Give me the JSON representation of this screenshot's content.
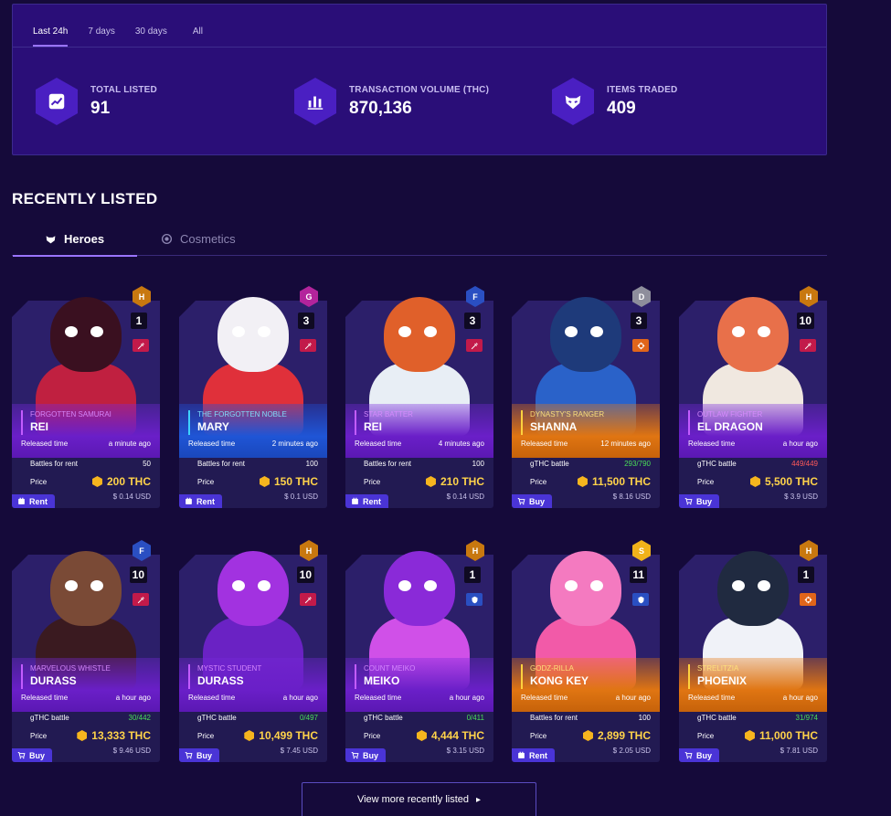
{
  "period_tabs": [
    "Last 24h",
    "7 days",
    "30 days",
    "All"
  ],
  "stats": [
    {
      "label": "TOTAL LISTED",
      "value": "91",
      "icon": "chart-up-icon"
    },
    {
      "label": "TRANSACTION VOLUME (THC)",
      "value": "870,136",
      "icon": "bar-chart-icon"
    },
    {
      "label": "ITEMS TRADED",
      "value": "409",
      "icon": "mask-icon"
    }
  ],
  "section_title": "RECENTLY LISTED",
  "category_tabs": [
    "Heroes",
    "Cosmetics"
  ],
  "row_labels": {
    "released": "Released time",
    "battles_rent": "Battles for rent",
    "gthc_battle": "gTHC battle",
    "price": "Price"
  },
  "cards": [
    {
      "sub": "FORGOTTEN SAMURAI",
      "name": "REI",
      "rank": "H",
      "level": "1",
      "time": "a minute ago",
      "row1_label": "Battles for rent",
      "row1_value": "50",
      "price": "200 THC",
      "usd": "$ 0.14 USD",
      "action": "Rent",
      "theme": "purple",
      "rank_color": "#c8780f",
      "cls_color": "#c21a4a",
      "char_color": "#c02040",
      "head_color": "#3a1020"
    },
    {
      "sub": "THE FORGOTTEN NOBLE",
      "name": "MARY",
      "rank": "G",
      "level": "3",
      "time": "2 minutes ago",
      "row1_label": "Battles for rent",
      "row1_value": "100",
      "price": "150 THC",
      "usd": "$ 0.1 USD",
      "action": "Rent",
      "theme": "blue",
      "rank_color": "#b3249c",
      "cls_color": "#c21a4a",
      "char_color": "#e0303a",
      "head_color": "#f2f0f5"
    },
    {
      "sub": "STAR BATTER",
      "name": "REI",
      "rank": "F",
      "level": "3",
      "time": "4 minutes ago",
      "row1_label": "Battles for rent",
      "row1_value": "100",
      "price": "210 THC",
      "usd": "$ 0.14 USD",
      "action": "Rent",
      "theme": "purple",
      "rank_color": "#2a4fc2",
      "cls_color": "#c21a4a",
      "char_color": "#e8eef5",
      "head_color": "#e0602a"
    },
    {
      "sub": "DYNASTY'S RANGER",
      "name": "SHANNA",
      "rank": "D",
      "level": "3",
      "time": "12 minutes ago",
      "row1_label": "gTHC battle",
      "row1_value": "293/790",
      "row1_class": "green",
      "price": "11,500 THC",
      "usd": "$ 8.16 USD",
      "action": "Buy",
      "theme": "orange",
      "rank_color": "#8e8e9c",
      "cls_color": "#e0651a",
      "char_color": "#2a62c9",
      "head_color": "#1e3a7a"
    },
    {
      "sub": "OUTLAW FIGHTER",
      "name": "EL DRAGON",
      "rank": "H",
      "level": "10",
      "time": "a hour ago",
      "row1_label": "gTHC battle",
      "row1_value": "449/449",
      "row1_class": "red",
      "price": "5,500 THC",
      "usd": "$ 3.9 USD",
      "action": "Buy",
      "theme": "purple",
      "rank_color": "#c8780f",
      "cls_color": "#c21a4a",
      "char_color": "#f0e8e0",
      "head_color": "#e8704a"
    },
    {
      "sub": "MARVELOUS WHISTLE",
      "name": "DURASS",
      "rank": "F",
      "level": "10",
      "time": "a hour ago",
      "row1_label": "gTHC battle",
      "row1_value": "30/442",
      "row1_class": "green",
      "price": "13,333 THC",
      "usd": "$ 9.46 USD",
      "action": "Buy",
      "theme": "purple",
      "rank_color": "#2a4fc2",
      "cls_color": "#c21a4a",
      "char_color": "#3a1a20",
      "head_color": "#7a4a36"
    },
    {
      "sub": "MYSTIC STUDENT",
      "name": "DURASS",
      "rank": "H",
      "level": "10",
      "time": "a hour ago",
      "row1_label": "gTHC battle",
      "row1_value": "0/497",
      "row1_class": "green",
      "price": "10,499 THC",
      "usd": "$ 7.45 USD",
      "action": "Buy",
      "theme": "purple",
      "rank_color": "#c8780f",
      "cls_color": "#c21a4a",
      "char_color": "#6a22c4",
      "head_color": "#a232e0"
    },
    {
      "sub": "COUNT MEIKO",
      "name": "MEIKO",
      "rank": "H",
      "level": "1",
      "time": "a hour ago",
      "row1_label": "gTHC battle",
      "row1_value": "0/411",
      "row1_class": "green",
      "price": "4,444 THC",
      "usd": "$ 3.15 USD",
      "action": "Buy",
      "theme": "purple",
      "rank_color": "#c8780f",
      "cls_color": "#2a4fc2",
      "char_color": "#d050e8",
      "head_color": "#8a2ad8"
    },
    {
      "sub": "GODZ-RILLA",
      "name": "KONG KEY",
      "rank": "S",
      "level": "11",
      "time": "a hour ago",
      "row1_label": "Battles for rent",
      "row1_value": "100",
      "price": "2,899 THC",
      "usd": "$ 2.05 USD",
      "action": "Rent",
      "theme": "orange",
      "rank_color": "#f0b21a",
      "cls_color": "#2a4fc2",
      "char_color": "#f25aa8",
      "head_color": "#f47ac0"
    },
    {
      "sub": "STRELITZIA",
      "name": "PHOENIX",
      "rank": "H",
      "level": "1",
      "time": "a hour ago",
      "row1_label": "gTHC battle",
      "row1_value": "31/974",
      "row1_class": "green",
      "price": "11,000 THC",
      "usd": "$ 7.81 USD",
      "action": "Buy",
      "theme": "orange",
      "rank_color": "#c8780f",
      "cls_color": "#e0651a",
      "char_color": "#f0f2f8",
      "head_color": "#202a40"
    }
  ],
  "view_more": "View more recently listed"
}
